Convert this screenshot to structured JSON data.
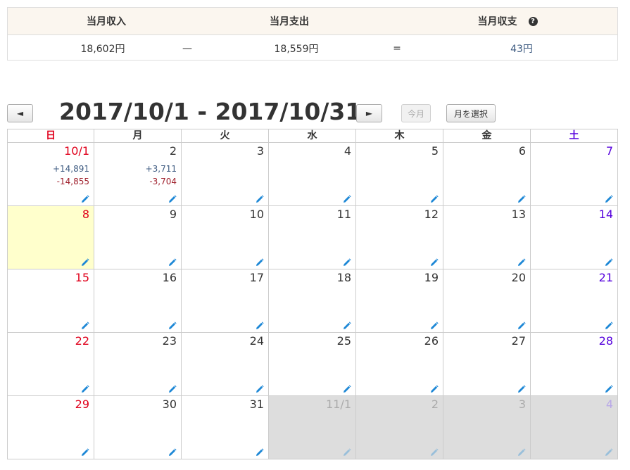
{
  "summary": {
    "income_label": "当月収入",
    "expense_label": "当月支出",
    "balance_label": "当月収支",
    "help": "?",
    "income_value": "18,602円",
    "minus_op": "—",
    "expense_value": "18,559円",
    "equals_op": "=",
    "balance_value": "43円"
  },
  "toolbar": {
    "prev": "◄",
    "title": "2017/10/1 - 2017/10/31",
    "next": "►",
    "today": "今月",
    "select_month": "月を選択"
  },
  "weekdays": [
    "日",
    "月",
    "火",
    "水",
    "木",
    "金",
    "土"
  ],
  "colors": {
    "sunday": "#e0001b",
    "saturday": "#5500dd",
    "income": "#3d5a80",
    "expense": "#a0222e",
    "today_bg": "#ffffcc",
    "other_month_bg": "#dddddd",
    "pencil": "#1e88d6"
  },
  "weeks": [
    [
      {
        "day": "10/1",
        "income": "+14,891",
        "expense": "-14,855"
      },
      {
        "day": "2",
        "income": "+3,711",
        "expense": "-3,704"
      },
      {
        "day": "3"
      },
      {
        "day": "4"
      },
      {
        "day": "5"
      },
      {
        "day": "6"
      },
      {
        "day": "7"
      }
    ],
    [
      {
        "day": "8",
        "today": true
      },
      {
        "day": "9"
      },
      {
        "day": "10"
      },
      {
        "day": "11"
      },
      {
        "day": "12"
      },
      {
        "day": "13"
      },
      {
        "day": "14"
      }
    ],
    [
      {
        "day": "15"
      },
      {
        "day": "16"
      },
      {
        "day": "17"
      },
      {
        "day": "18"
      },
      {
        "day": "19"
      },
      {
        "day": "20"
      },
      {
        "day": "21"
      }
    ],
    [
      {
        "day": "22"
      },
      {
        "day": "23"
      },
      {
        "day": "24"
      },
      {
        "day": "25"
      },
      {
        "day": "26"
      },
      {
        "day": "27"
      },
      {
        "day": "28"
      }
    ],
    [
      {
        "day": "29"
      },
      {
        "day": "30"
      },
      {
        "day": "31"
      },
      {
        "day": "11/1",
        "other": true
      },
      {
        "day": "2",
        "other": true
      },
      {
        "day": "3",
        "other": true
      },
      {
        "day": "4",
        "other": true
      }
    ]
  ]
}
